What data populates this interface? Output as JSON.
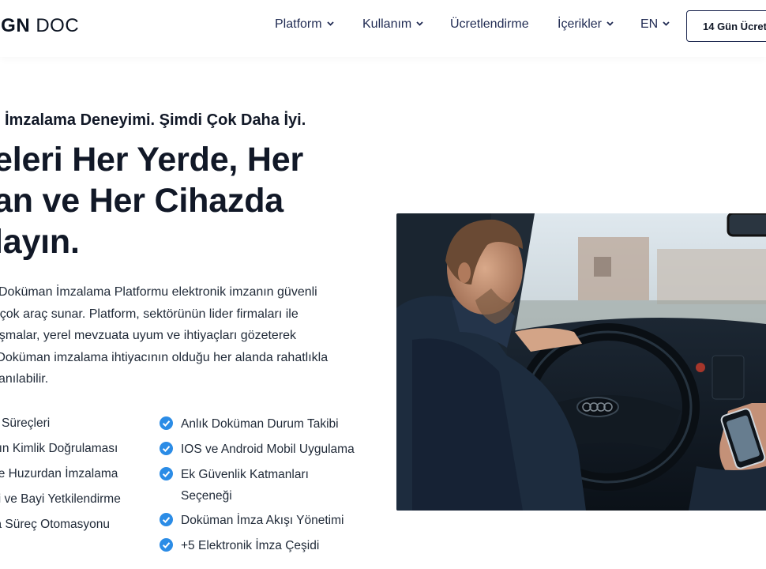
{
  "header": {
    "logo_bold": "IGN",
    "logo_light": "DOC",
    "nav": [
      {
        "label": "Platform",
        "dropdown": true
      },
      {
        "label": "Kullanım",
        "dropdown": true
      },
      {
        "label": "Ücretlendirme",
        "dropdown": false
      },
      {
        "label": "İçerikler",
        "dropdown": true
      },
      {
        "label": "EN",
        "dropdown": true
      }
    ],
    "cta_label": "14 Gün Ücret"
  },
  "hero": {
    "eyebrow": "İmzalama Deneyimi. Şimdi Çok Daha İyi.",
    "title_lines": [
      "eleri Her Yerde, Her",
      "an ve Her Cihazda",
      "layın."
    ],
    "paragraph_lines": [
      "C Doküman İmzalama Platformu elektronik imzanın güvenli",
      "birçok araç sunar. Platform, sektörünün lider firmaları ile",
      "alışmalar, yerel mevzuata uyum ve ihtiyaçları gözeterek",
      "r. Doküman imzalama ihtiyacının olduğu her alanda rahatlıkla",
      "ullanılabilir."
    ]
  },
  "features_left": [
    "ş Süreçleri",
    "nın Kimlik Doğrulaması",
    "ve Huzurdan İmzalama",
    "si ve Bayi Yetkilendirme",
    "la Süreç Otomasyonu"
  ],
  "features_right": [
    {
      "line1": "Anlık Doküman Durum Takibi",
      "line2": ""
    },
    {
      "line1": "IOS ve Android Mobil Uygulama",
      "line2": ""
    },
    {
      "line1": "Ek Güvenlik Katmanları",
      "line2": "Seçeneği"
    },
    {
      "line1": "Doküman İmza Akışı Yönetimi",
      "line2": ""
    },
    {
      "line1": "+5 Elektronik İmza Çeşidi",
      "line2": ""
    }
  ],
  "colors": {
    "check": "#2b8ce6",
    "nav_text": "#1f2a52",
    "heading": "#111827"
  },
  "icons": {
    "check": "check-circle-icon",
    "dropdown": "chevron-down-icon"
  }
}
